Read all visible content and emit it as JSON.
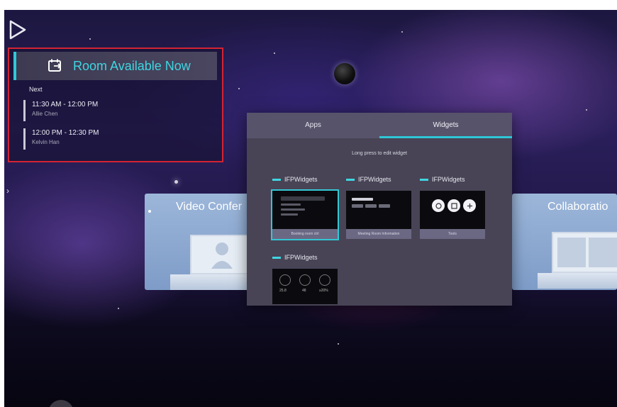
{
  "room_widget": {
    "status": "Room Available Now",
    "next_label": "Next",
    "meetings": [
      {
        "time": "11:30 AM - 12:00 PM",
        "person": "Allie Chen"
      },
      {
        "time": "12:00 PM - 12:30 PM",
        "person": "Kelvin Han"
      }
    ]
  },
  "background_cards": {
    "left_title": "Video Confer",
    "right_title": "Collaboratio"
  },
  "panel": {
    "tabs": [
      {
        "label": "Apps",
        "active": false
      },
      {
        "label": "Widgets",
        "active": true
      }
    ],
    "hint": "Long press to edit widget",
    "widgets": [
      {
        "group": "IFPWidgets",
        "caption": "Booking room ctrl"
      },
      {
        "group": "IFPWidgets",
        "caption": "Meeting Room Information"
      },
      {
        "group": "IFPWidgets",
        "caption": "Tools"
      },
      {
        "group": "IFPWidgets",
        "caption": "",
        "values": [
          "25.8",
          "48",
          "≥20%"
        ]
      }
    ]
  },
  "colors": {
    "accent": "#3fd6e0",
    "highlight_border": "#d42333",
    "panel_bg": "#484456"
  },
  "icons": [
    "play-triangle-icon",
    "calendar-icon",
    "chevron-right-icon",
    "tool-circle-icon",
    "dial-gauge-icon"
  ]
}
